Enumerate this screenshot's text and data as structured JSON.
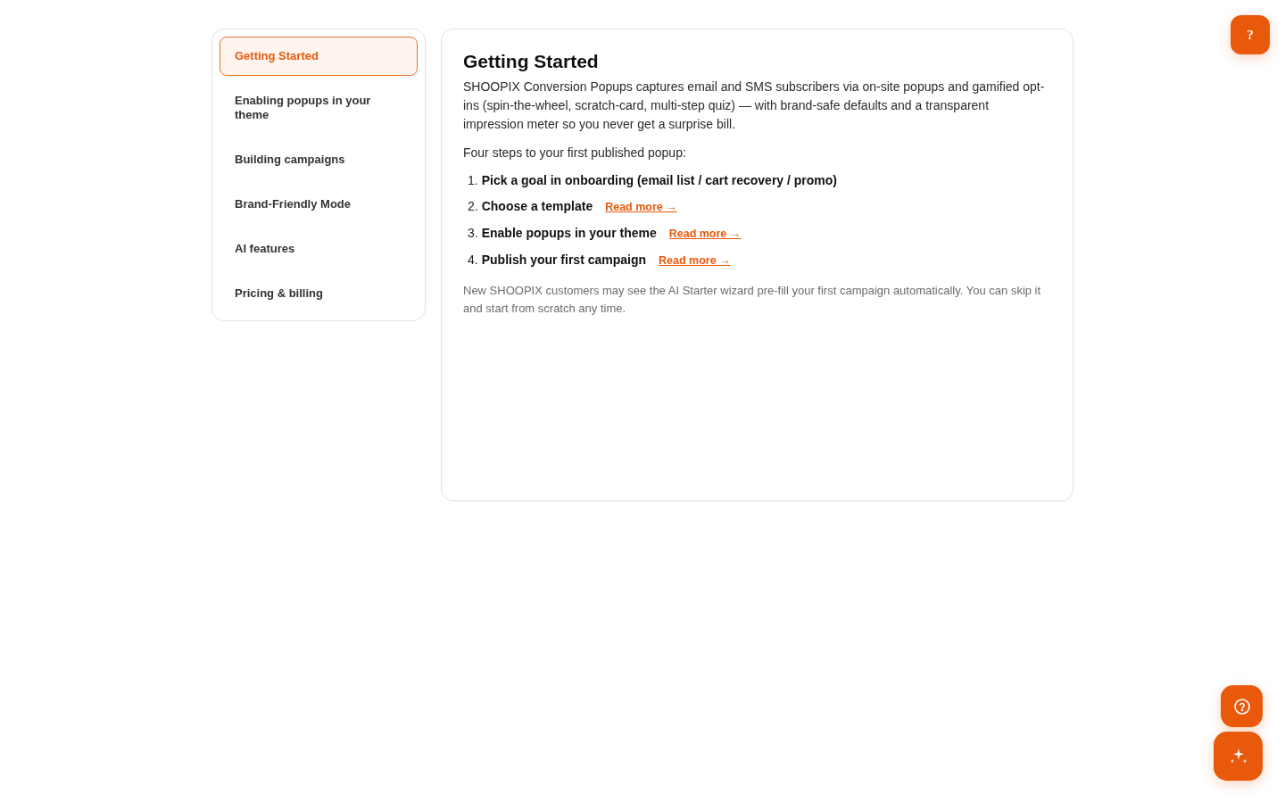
{
  "sidebar": {
    "items": [
      {
        "label": "Getting Started",
        "selected": true
      },
      {
        "label": "Enabling popups in your theme",
        "selected": false
      },
      {
        "label": "Building campaigns",
        "selected": false
      },
      {
        "label": "Brand-Friendly Mode",
        "selected": false
      },
      {
        "label": "AI features",
        "selected": false
      },
      {
        "label": "Pricing & billing",
        "selected": false
      }
    ]
  },
  "article": {
    "title": "Getting Started",
    "intro": "SHOOPIX Conversion Popups captures email and SMS subscribers via on-site popups and gamified opt-ins (spin-the-wheel, scratch-card, multi-step quiz) — with brand-safe defaults and a transparent impression meter so you never get a surprise bill.",
    "steps_heading": "Four steps to your first published popup:",
    "steps": [
      {
        "number": "1.",
        "text": "Pick a goal in onboarding (email list / cart recovery / promo)"
      },
      {
        "number": "2.",
        "text": "Choose a template",
        "link": "Read more →"
      },
      {
        "number": "3.",
        "text": "Enable popups in your theme",
        "link": "Read more →"
      },
      {
        "number": "4.",
        "text": "Publish your first campaign",
        "link": "Read more →"
      }
    ],
    "note": "New SHOOPIX customers may see the AI Starter wizard pre-fill your first campaign automatically. You can skip it and start from scratch any time."
  },
  "corner_help_button": {
    "label": "?"
  }
}
